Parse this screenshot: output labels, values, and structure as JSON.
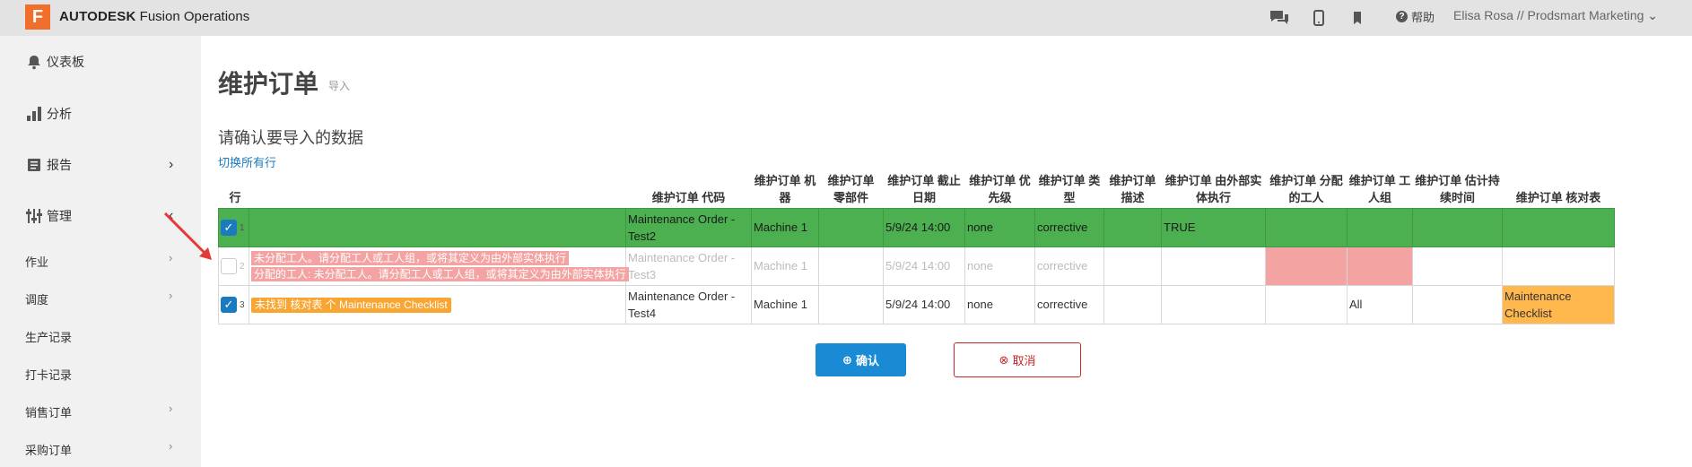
{
  "topbar": {
    "logo_letter": "F",
    "brand_strong": "AUTODESK",
    "brand_rest": " Fusion Operations",
    "icons": [
      "chat-icon",
      "mobile-icon",
      "bookmark-icon"
    ],
    "help_label": "帮助",
    "user": "Elisa Rosa // Prodsmart Marketing"
  },
  "sidebar": {
    "items": [
      {
        "label": "仪表板",
        "icon": "bell-icon"
      },
      {
        "label": "分析",
        "icon": "bar-chart-icon"
      },
      {
        "label": "报告",
        "icon": "report-icon",
        "chevron": "›"
      },
      {
        "label": "管理",
        "icon": "manage-icon",
        "chevron": "‹"
      }
    ],
    "sub_items": [
      "作业",
      "调度",
      "生产记录",
      "打卡记录",
      "销售订单",
      "采购订单"
    ]
  },
  "main": {
    "title": "维护订单",
    "subtitle": "导入",
    "heading": "请确认要导入的数据",
    "toggle_all": "切换所有行"
  },
  "table": {
    "headers": [
      "行",
      "",
      "维护订单 代码",
      "维护订单 机器",
      "维护订单 零部件",
      "维护订单 截止日期",
      "维护订单 优先级",
      "维护订单 类型",
      "维护订单 描述",
      "维护订单 由外部实体执行",
      "维护订单 分配的工人",
      "维护订单 工人组",
      "维护订单 估计持续时间",
      "维护订单 核对表"
    ],
    "rows": [
      {
        "num": "1",
        "code": "Maintenance Order - Test2",
        "machine": "Machine 1",
        "part": "",
        "due": "5/9/24 14:00",
        "priority": "none",
        "type": "corrective",
        "desc": "",
        "external": "TRUE",
        "worker": "",
        "group": "",
        "duration": "",
        "checklist": ""
      },
      {
        "num": "2",
        "error1": "未分配工人。请分配工人或工人组，或将其定义为由外部实体执行",
        "error2": "分配的工人: 未分配工人。请分配工人或工人组，或将其定义为由外部实体执行",
        "code": "Maintenance Order - Test3",
        "machine": "Machine 1",
        "part": "",
        "due": "5/9/24 14:00",
        "priority": "none",
        "type": "corrective",
        "desc": "",
        "external": "",
        "worker": "",
        "group": "",
        "duration": "",
        "checklist": ""
      },
      {
        "num": "3",
        "warning": "未找到 核对表 个 Maintenance Checklist",
        "code": "Maintenance Order - Test4",
        "machine": "Machine 1",
        "part": "",
        "due": "5/9/24 14:00",
        "priority": "none",
        "type": "corrective",
        "desc": "",
        "external": "",
        "worker": "",
        "group": "All",
        "duration": "",
        "checklist": "Maintenance Checklist"
      }
    ]
  },
  "buttons": {
    "confirm": "确认",
    "cancel": "取消"
  },
  "colors": {
    "accent": "#1a8ad4",
    "ok_row": "#4caf50",
    "error": "#f4a3a3",
    "warning": "#f8a531",
    "danger": "#c62828"
  }
}
